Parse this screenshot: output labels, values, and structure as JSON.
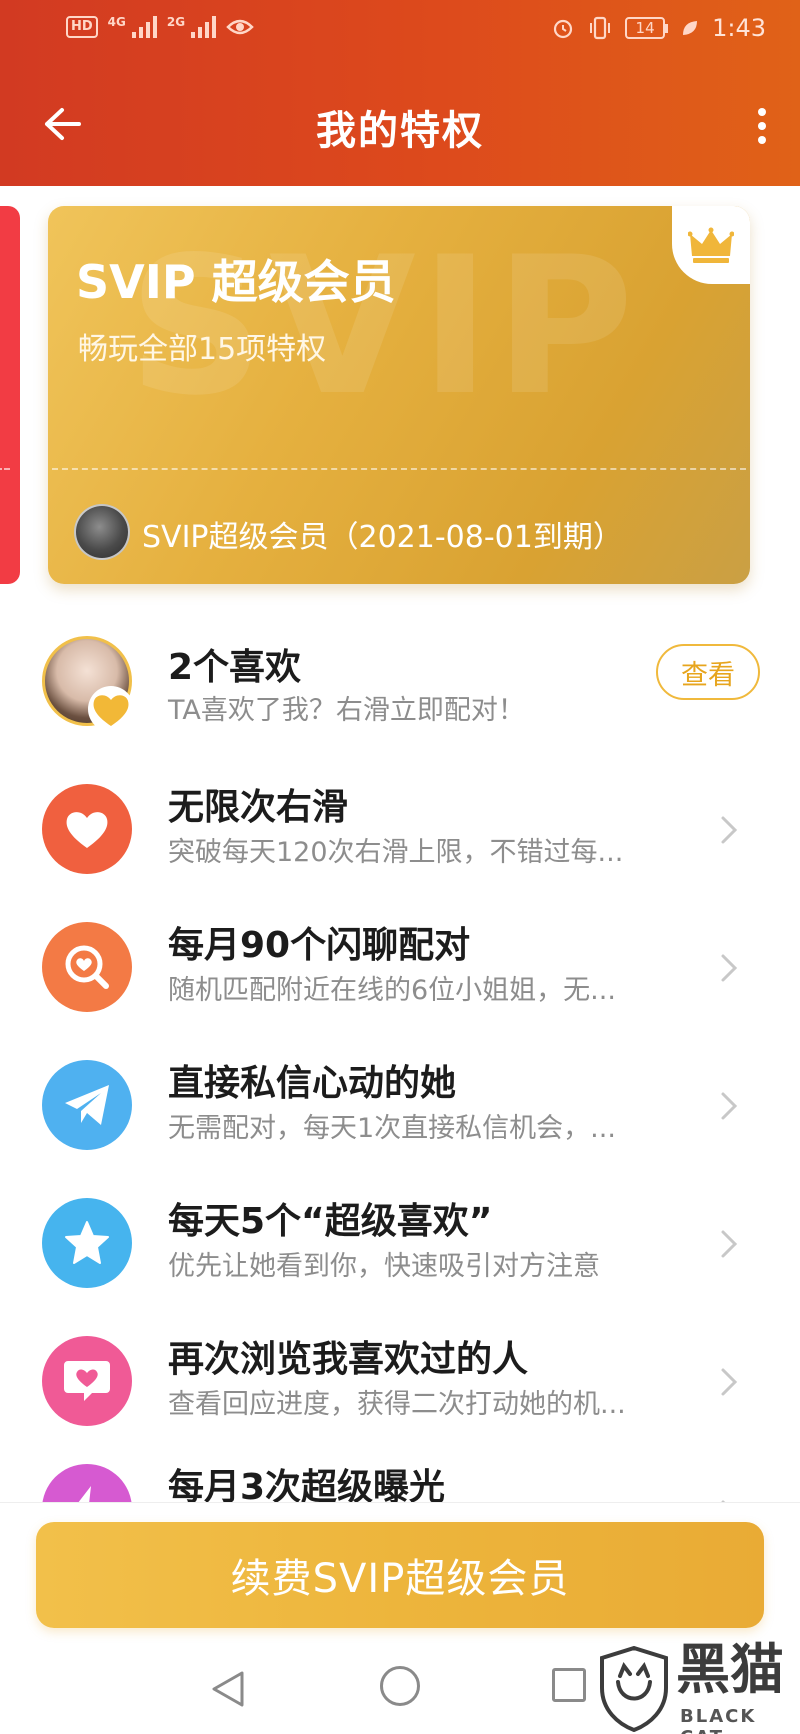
{
  "status_bar": {
    "hd": "HD",
    "net1": "4G",
    "net2": "2G",
    "battery": "14",
    "time": "1:43"
  },
  "header": {
    "title": "我的特权"
  },
  "vip_card": {
    "watermark": "SVIP",
    "title": "SVIP 超级会员",
    "subtitle": "畅玩全部15项特权",
    "expire_text": "SVIP超级会员（2021-08-01到期）"
  },
  "likes": {
    "title": "2个喜欢",
    "desc": "TA喜欢了我？右滑立即配对！",
    "view_label": "查看"
  },
  "privileges": [
    {
      "title": "无限次右滑",
      "desc": "突破每天120次右滑上限，不错过每...",
      "color": "#f0603f",
      "icon": "heart-icon"
    },
    {
      "title": "每月90个闪聊配对",
      "desc": "随机匹配附近在线的6位小姐姐，无...",
      "color": "#f37a45",
      "icon": "search-icon"
    },
    {
      "title": "直接私信心动的她",
      "desc": "无需配对，每天1次直接私信机会，...",
      "color": "#4fb1f0",
      "icon": "paper-plane-icon"
    },
    {
      "title": "每天5个“超级喜欢”",
      "desc": "优先让她看到你，快速吸引对方注意",
      "color": "#46b4ee",
      "icon": "star-icon"
    },
    {
      "title": "再次浏览我喜欢过的人",
      "desc": "查看回应进度，获得二次打动她的机...",
      "color": "#f05a96",
      "icon": "heart-chat-icon"
    },
    {
      "title": "每月3次超级曝光",
      "desc": "",
      "color": "#d65ad1",
      "icon": "bolt-icon"
    }
  ],
  "bottom": {
    "renew_label": "续费SVIP超级会员"
  },
  "watermark": {
    "text": "黑猫",
    "sub": "BLACK CAT"
  }
}
